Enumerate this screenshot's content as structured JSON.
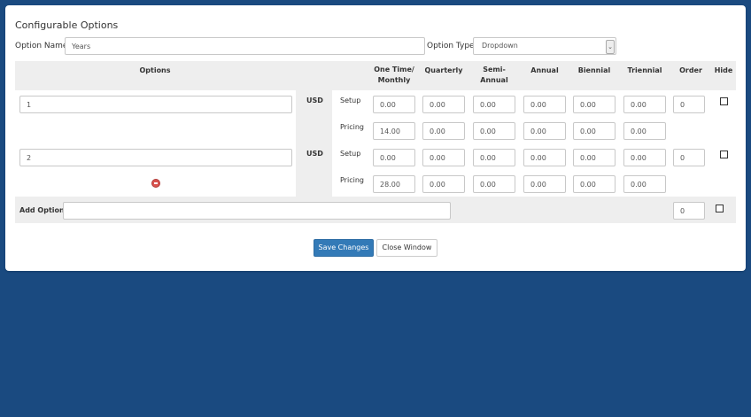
{
  "panel": {
    "title": "Configurable Options",
    "option_name_label": "Option Name:",
    "option_name_value": "Years",
    "option_type_label": "Option Type:",
    "option_type_value": "Dropdown"
  },
  "table": {
    "headers": {
      "options": "Options",
      "one_time_monthly": "One Time/ Monthly",
      "quarterly": "Quarterly",
      "semi_annual": "Semi- Annual",
      "annual": "Annual",
      "biennial": "Biennial",
      "triennial": "Triennial",
      "order": "Order",
      "hide": "Hide"
    },
    "currency": "USD",
    "setup_label": "Setup",
    "pricing_label": "Pricing",
    "rows": [
      {
        "name": "1",
        "order": "0",
        "setup": [
          "0.00",
          "0.00",
          "0.00",
          "0.00",
          "0.00",
          "0.00"
        ],
        "pricing": [
          "14.00",
          "0.00",
          "0.00",
          "0.00",
          "0.00",
          "0.00"
        ]
      },
      {
        "name": "2",
        "order": "0",
        "setup": [
          "0.00",
          "0.00",
          "0.00",
          "0.00",
          "0.00",
          "0.00"
        ],
        "pricing": [
          "28.00",
          "0.00",
          "0.00",
          "0.00",
          "0.00",
          "0.00"
        ]
      }
    ],
    "add_option_label": "Add Option:",
    "add_option_value": "",
    "add_order": "0"
  },
  "buttons": {
    "save": "Save Changes",
    "close": "Close Window"
  },
  "colors": {
    "background": "#1a4a80",
    "primary": "#337ab7",
    "delete": "#d9534f"
  }
}
